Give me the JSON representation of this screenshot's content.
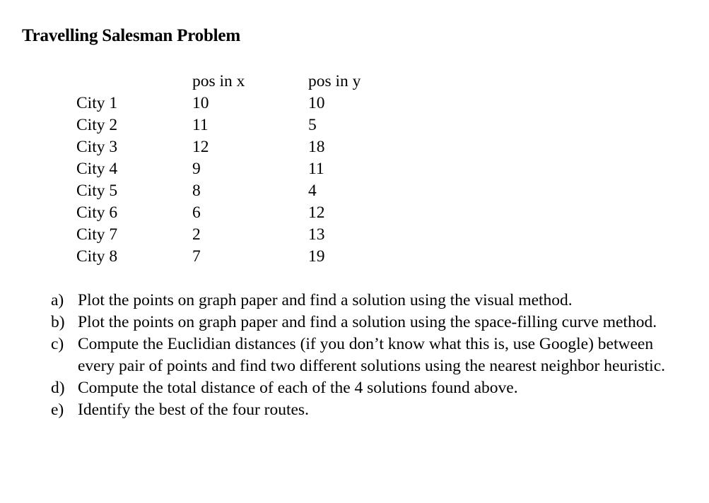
{
  "document": {
    "title": "Travelling Salesman Problem"
  },
  "table": {
    "headers": [
      "",
      "pos in x",
      "pos in y"
    ],
    "rows": [
      {
        "city": "City 1",
        "x": "10",
        "y": "10"
      },
      {
        "city": "City 2",
        "x": "11",
        "y": "5"
      },
      {
        "city": "City 3",
        "x": "12",
        "y": "18"
      },
      {
        "city": "City 4",
        "x": "9",
        "y": "11"
      },
      {
        "city": "City 5",
        "x": "8",
        "y": "4"
      },
      {
        "city": "City 6",
        "x": "6",
        "y": "12"
      },
      {
        "city": "City 7",
        "x": "2",
        "y": "13"
      },
      {
        "city": "City 8",
        "x": "7",
        "y": "19"
      }
    ]
  },
  "questions": [
    {
      "marker": "a)",
      "text": "Plot the points on graph paper and find a solution using the visual method."
    },
    {
      "marker": "b)",
      "text": "Plot the points on graph paper and find a solution using the space-filling curve method."
    },
    {
      "marker": "c)",
      "text": "Compute the Euclidian distances (if you don’t know what this is, use Google) between every pair of points and find two different solutions using the nearest neighbor heuristic."
    },
    {
      "marker": "d)",
      "text": "Compute the total distance of each of the 4 solutions found above."
    },
    {
      "marker": "e)",
      "text": "Identify the best of the four routes."
    }
  ]
}
